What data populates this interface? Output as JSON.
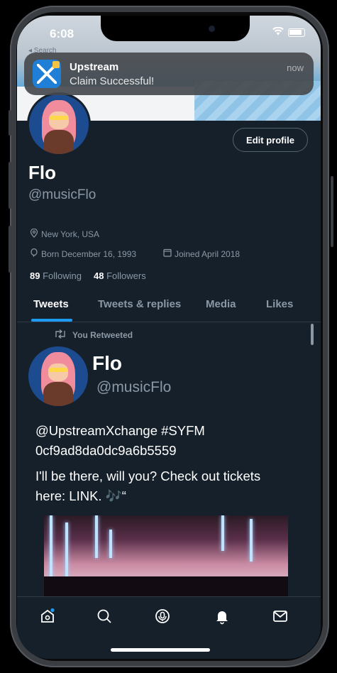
{
  "status": {
    "time": "6:08",
    "back_label": "◂ Search"
  },
  "notification": {
    "app": "Upstream",
    "message": "Claim Successful!",
    "time": "now"
  },
  "profile": {
    "edit_label": "Edit profile",
    "name": "Flo",
    "handle": "@musicFlo",
    "location": "New York, USA",
    "born": "Born December 16, 1993",
    "joined": "Joined April 2018",
    "following_count": "89",
    "following_label": "Following",
    "followers_count": "48",
    "followers_label": "Followers"
  },
  "tabs": [
    {
      "label": "Tweets"
    },
    {
      "label": "Tweets & replies"
    },
    {
      "label": "Media"
    },
    {
      "label": "Likes"
    }
  ],
  "tweet": {
    "retweet_label": "You Retweeted",
    "name": "Flo",
    "handle": "@musicFlo",
    "line1": "@UpstreamXchange #SYFM",
    "line2": "0cf9ad8da0dc9a6b5559",
    "line3": "I'll be there, will you? Check out tickets",
    "line4": "here: LINK. 🎶“"
  },
  "colors": {
    "accent": "#1d9bf0",
    "background": "#15202b",
    "muted": "#8b98a5"
  },
  "bottom_nav": [
    "home-icon",
    "search-icon",
    "spaces-icon",
    "notifications-icon",
    "messages-icon"
  ]
}
